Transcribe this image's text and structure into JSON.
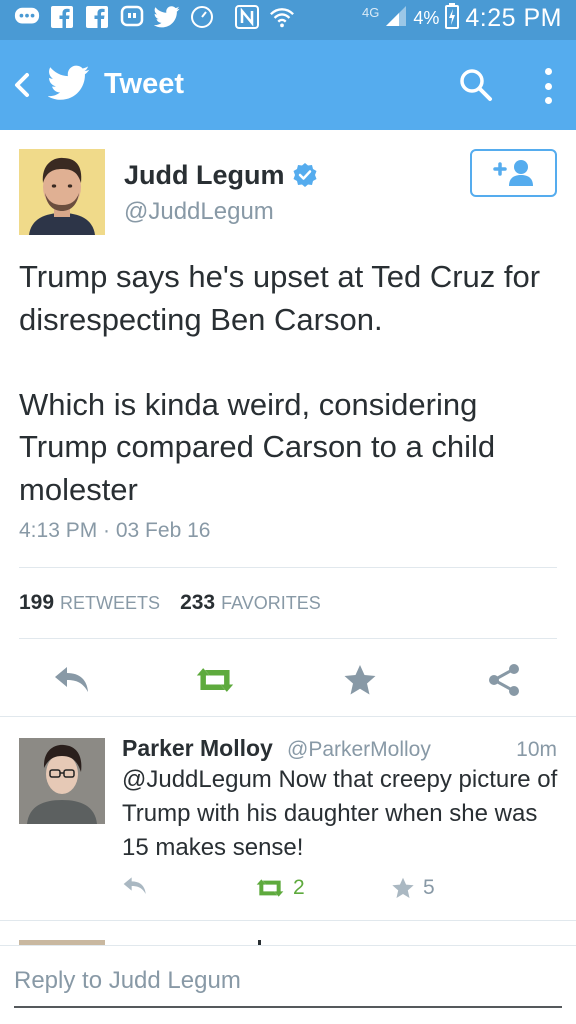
{
  "status_bar": {
    "time": "4:25 PM",
    "battery": "4%",
    "network": "4G",
    "icons": [
      "messages-icon",
      "facebook-icon",
      "facebook-icon",
      "hangouts-icon",
      "twitter-icon",
      "clock-icon",
      "nfc-icon",
      "wifi-icon",
      "signal-icon",
      "battery-icon"
    ]
  },
  "app_bar": {
    "title": "Tweet",
    "bg_color": "#55acee"
  },
  "tweet": {
    "author_name": "Judd Legum",
    "author_handle": "@JuddLegum",
    "text": "Trump says he's upset at Ted Cruz for disrespecting Ben Carson.\n\nWhich is kinda weird, considering Trump compared Carson to a child molester",
    "timestamp": "4:13 PM · 03 Feb 16",
    "retweets_count": "199",
    "retweets_label": "RETWEETS",
    "favorites_count": "233",
    "favorites_label": "FAVORITES"
  },
  "reply_tweet": {
    "author_name": "Parker Molloy",
    "author_handle": "@ParkerMolloy",
    "time_ago": "10m",
    "text": "@JuddLegum Now that creepy picture of Trump with his daughter when she was 15 makes sense!",
    "retweet_count": "2",
    "favorite_count": "5"
  },
  "reply_bar": {
    "placeholder": "Reply to Judd Legum"
  },
  "colors": {
    "accent": "#55acee",
    "retweet_green": "#5eaa3d",
    "muted": "#8899a6",
    "text": "#292f33"
  }
}
